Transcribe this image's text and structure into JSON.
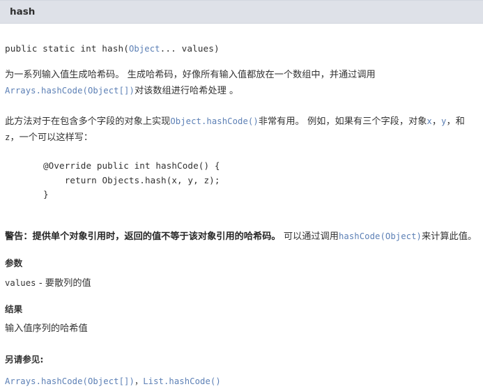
{
  "header": {
    "title": "hash"
  },
  "signature": {
    "prefix": "public static int hash(",
    "link": "Object",
    "suffix": "... values)"
  },
  "description": {
    "para1_a": "为一系列输入值生成哈希码。 生成哈希码，好像所有输入值都放在一个数组中，并通过调用",
    "para1_link": "Arrays.hashCode(Object[])",
    "para1_b": "对该数组进行哈希处理 。",
    "para2_a": "此方法对于在包含多个字段的对象上实现",
    "para2_link": "Object.hashCode()",
    "para2_b": "非常有用。 例如，如果有三个字段，对象",
    "para2_var_x": "x",
    "para2_c": "，",
    "para2_var_y": "y",
    "para2_d": "，和",
    "para2_var_z": "z",
    "para2_e": "，一个可以这样写："
  },
  "code_block": "@Override public int hashCode() {\n    return Objects.hash(x, y, z);\n}",
  "warning": {
    "bold": "警告：提供单个对象引用时，返回的值不等于该对象引用的哈希码。",
    "rest_a": " 可以通过调用",
    "rest_link": "hashCode(Object)",
    "rest_b": "来计算此值。"
  },
  "params": {
    "heading": "参数",
    "name": "values",
    "separator": " - ",
    "desc": "要散列的值"
  },
  "returns": {
    "heading": "结果",
    "desc": "输入值序列的哈希值"
  },
  "seealso": {
    "heading": "另请参见:",
    "links": [
      "Arrays.hashCode(Object[])",
      "List.hashCode()"
    ],
    "separator": "，"
  },
  "colors": {
    "header_bg": "#dee1e8",
    "link": "#5b7fb5",
    "text": "#333333"
  }
}
